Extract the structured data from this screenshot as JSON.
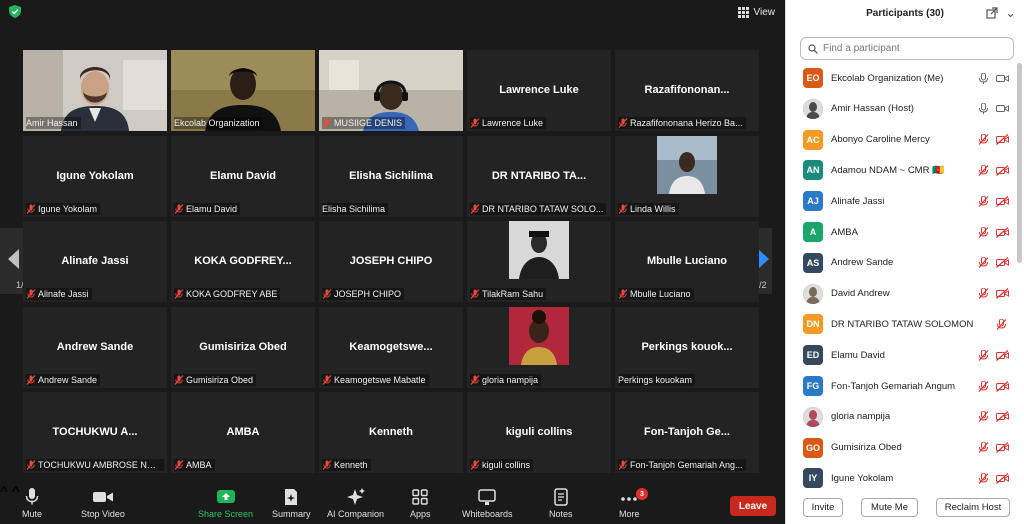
{
  "top": {
    "view_label": "View"
  },
  "tiles": [
    {
      "name": "Amir Hassan",
      "label": "Amir Hassan",
      "muted": false,
      "photo": "man-suit"
    },
    {
      "name": "Ekcolab Organization",
      "label": "Ekcolab Organization",
      "muted": false,
      "photo": "man-dark",
      "active": true
    },
    {
      "name": "MUSIIGE DENIS",
      "label": "MUSIIGE DENIS",
      "muted": true,
      "photo": "man-headset"
    },
    {
      "name": "Lawrence Luke",
      "label": "Lawrence Luke",
      "muted": true
    },
    {
      "name": "Razafifononan...",
      "label": "Razafifononana Herizo Ba...",
      "muted": true
    },
    {
      "name": "Igune Yokolam",
      "label": "Igune Yokolam",
      "muted": true
    },
    {
      "name": "Elamu David",
      "label": "Elamu David",
      "muted": true
    },
    {
      "name": "Elisha Sichilima",
      "label": "Elisha Sichilima",
      "muted": false
    },
    {
      "name": "DR NTARIBO TA...",
      "label": "DR NTARIBO TATAW SOLO...",
      "muted": true
    },
    {
      "name": "Linda Willis",
      "label": "Linda Willis",
      "muted": true,
      "photo": "small-photo"
    },
    {
      "name": "Alinafe Jassi",
      "label": "Alinafe Jassi",
      "muted": true
    },
    {
      "name": "KOKA GODFREY...",
      "label": "KOKA GODFREY ABE",
      "muted": true
    },
    {
      "name": "JOSEPH CHIPO",
      "label": "JOSEPH CHIPO",
      "muted": true
    },
    {
      "name": "TilakRam Sahu",
      "label": "TilakRam Sahu",
      "muted": true,
      "photo": "small-photo-gray"
    },
    {
      "name": "Mbulle Luciano",
      "label": "Mbulle Luciano",
      "muted": true
    },
    {
      "name": "Andrew Sande",
      "label": "Andrew Sande",
      "muted": true
    },
    {
      "name": "Gumisiriza Obed",
      "label": "Gumisiriza Obed",
      "muted": true
    },
    {
      "name": "Keamogetswe...",
      "label": "Keamogetswe Mabatle",
      "muted": true
    },
    {
      "name": "gloria nampija",
      "label": "gloria nampija",
      "muted": true,
      "photo": "small-photo-red"
    },
    {
      "name": "Perkings kouok...",
      "label": "Perkings kouokam",
      "muted": false
    },
    {
      "name": "TOCHUKWU A...",
      "label": "TOCHUKWU AMBROSE NG...",
      "muted": true
    },
    {
      "name": "AMBA",
      "label": "AMBA",
      "muted": true
    },
    {
      "name": "Kenneth",
      "label": "Kenneth",
      "muted": true
    },
    {
      "name": "kiguli collins",
      "label": "kiguli collins",
      "muted": true
    },
    {
      "name": "Fon-Tanjoh Ge...",
      "label": "Fon-Tanjoh Gemariah Ang...",
      "muted": true
    }
  ],
  "pagination": {
    "left": "1/2",
    "right": "1/2"
  },
  "toolbar": {
    "mute": "Mute",
    "stop_video": "Stop Video",
    "share_screen": "Share Screen",
    "summary": "Summary",
    "ai_companion": "AI Companion",
    "apps": "Apps",
    "whiteboards": "Whiteboards",
    "notes": "Notes",
    "more": "More",
    "more_badge": "3",
    "leave": "Leave"
  },
  "panel": {
    "title": "Participants (30)",
    "search_placeholder": "Find a participant",
    "participants": [
      {
        "initials": "EO",
        "color": "#d85a16",
        "name": "Ekcolab Organization (Me)",
        "mic": "on",
        "video": "on"
      },
      {
        "initials": "",
        "color": "#4a4a4a",
        "name": "Amir Hassan (Host)",
        "mic": "on",
        "video": "on",
        "photo": true
      },
      {
        "initials": "AC",
        "color": "#f29a24",
        "name": "Abonyo Caroline Mercy",
        "mic": "off",
        "video": "off"
      },
      {
        "initials": "AN",
        "color": "#1a8a7a",
        "name": "Adamou NDAM ~ CMR 🇨🇲",
        "mic": "off",
        "video": "off"
      },
      {
        "initials": "AJ",
        "color": "#2a7ac8",
        "name": "Alinafe Jassi",
        "mic": "off",
        "video": "off"
      },
      {
        "initials": "A",
        "color": "#1aa56a",
        "name": "AMBA",
        "mic": "off",
        "video": "off"
      },
      {
        "initials": "AS",
        "color": "#34495e",
        "name": "Andrew Sande",
        "mic": "off",
        "video": "off"
      },
      {
        "initials": "",
        "color": "#7a6a5a",
        "name": "David Andrew",
        "mic": "off",
        "video": "off",
        "photo": true
      },
      {
        "initials": "DN",
        "color": "#f29a24",
        "name": "DR NTARIBO TATAW SOLOMON",
        "mic": "off",
        "video": "none"
      },
      {
        "initials": "ED",
        "color": "#34495e",
        "name": "Elamu David",
        "mic": "off",
        "video": "off"
      },
      {
        "initials": "FG",
        "color": "#2a7ac8",
        "name": "Fon-Tanjoh Gemariah Angum",
        "mic": "off",
        "video": "off"
      },
      {
        "initials": "",
        "color": "#b04a5a",
        "name": "gloria nampija",
        "mic": "off",
        "video": "off",
        "photo": true
      },
      {
        "initials": "GO",
        "color": "#d85a16",
        "name": "Gumisiriza Obed",
        "mic": "off",
        "video": "off"
      },
      {
        "initials": "IY",
        "color": "#34495e",
        "name": "Igune Yokolam",
        "mic": "off",
        "video": "off"
      }
    ],
    "invite": "Invite",
    "mute_me": "Mute Me",
    "reclaim_host": "Reclaim Host"
  }
}
